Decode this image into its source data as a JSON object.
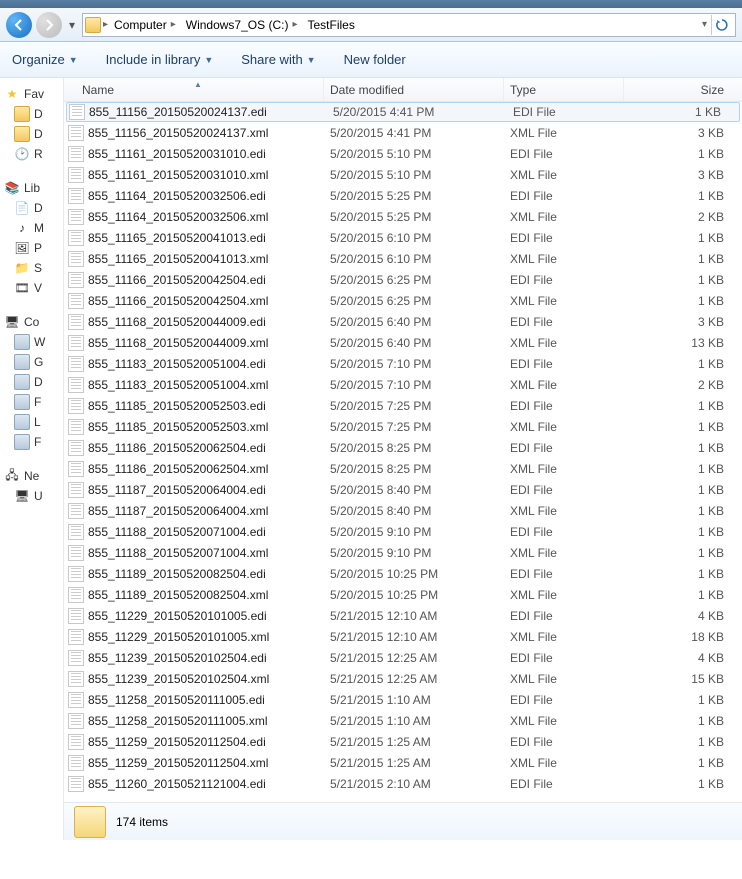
{
  "breadcrumb": [
    "Computer",
    "Windows7_OS (C:)",
    "TestFiles"
  ],
  "toolbar": {
    "organize": "Organize",
    "include": "Include in library",
    "share": "Share with",
    "newfolder": "New folder"
  },
  "columns": {
    "name": "Name",
    "date": "Date modified",
    "type": "Type",
    "size": "Size"
  },
  "sidebar": {
    "fav": "Fav",
    "fav_items": [
      "D",
      "D",
      "R"
    ],
    "lib": "Lib",
    "lib_items": [
      "D",
      "M",
      "P",
      "S",
      "V"
    ],
    "comp": "Co",
    "comp_items": [
      "W",
      "G",
      "D",
      "F",
      "L",
      "F"
    ],
    "net": "Ne",
    "net_items": [
      "U"
    ]
  },
  "files": [
    {
      "name": "855_11156_20150520024137.edi",
      "date": "5/20/2015 4:41 PM",
      "type": "EDI File",
      "size": "1 KB",
      "sel": true
    },
    {
      "name": "855_11156_20150520024137.xml",
      "date": "5/20/2015 4:41 PM",
      "type": "XML File",
      "size": "3 KB"
    },
    {
      "name": "855_11161_20150520031010.edi",
      "date": "5/20/2015 5:10 PM",
      "type": "EDI File",
      "size": "1 KB"
    },
    {
      "name": "855_11161_20150520031010.xml",
      "date": "5/20/2015 5:10 PM",
      "type": "XML File",
      "size": "3 KB"
    },
    {
      "name": "855_11164_20150520032506.edi",
      "date": "5/20/2015 5:25 PM",
      "type": "EDI File",
      "size": "1 KB"
    },
    {
      "name": "855_11164_20150520032506.xml",
      "date": "5/20/2015 5:25 PM",
      "type": "XML File",
      "size": "2 KB"
    },
    {
      "name": "855_11165_20150520041013.edi",
      "date": "5/20/2015 6:10 PM",
      "type": "EDI File",
      "size": "1 KB"
    },
    {
      "name": "855_11165_20150520041013.xml",
      "date": "5/20/2015 6:10 PM",
      "type": "XML File",
      "size": "1 KB"
    },
    {
      "name": "855_11166_20150520042504.edi",
      "date": "5/20/2015 6:25 PM",
      "type": "EDI File",
      "size": "1 KB"
    },
    {
      "name": "855_11166_20150520042504.xml",
      "date": "5/20/2015 6:25 PM",
      "type": "XML File",
      "size": "1 KB"
    },
    {
      "name": "855_11168_20150520044009.edi",
      "date": "5/20/2015 6:40 PM",
      "type": "EDI File",
      "size": "3 KB"
    },
    {
      "name": "855_11168_20150520044009.xml",
      "date": "5/20/2015 6:40 PM",
      "type": "XML File",
      "size": "13 KB"
    },
    {
      "name": "855_11183_20150520051004.edi",
      "date": "5/20/2015 7:10 PM",
      "type": "EDI File",
      "size": "1 KB"
    },
    {
      "name": "855_11183_20150520051004.xml",
      "date": "5/20/2015 7:10 PM",
      "type": "XML File",
      "size": "2 KB"
    },
    {
      "name": "855_11185_20150520052503.edi",
      "date": "5/20/2015 7:25 PM",
      "type": "EDI File",
      "size": "1 KB"
    },
    {
      "name": "855_11185_20150520052503.xml",
      "date": "5/20/2015 7:25 PM",
      "type": "XML File",
      "size": "1 KB"
    },
    {
      "name": "855_11186_20150520062504.edi",
      "date": "5/20/2015 8:25 PM",
      "type": "EDI File",
      "size": "1 KB"
    },
    {
      "name": "855_11186_20150520062504.xml",
      "date": "5/20/2015 8:25 PM",
      "type": "XML File",
      "size": "1 KB"
    },
    {
      "name": "855_11187_20150520064004.edi",
      "date": "5/20/2015 8:40 PM",
      "type": "EDI File",
      "size": "1 KB"
    },
    {
      "name": "855_11187_20150520064004.xml",
      "date": "5/20/2015 8:40 PM",
      "type": "XML File",
      "size": "1 KB"
    },
    {
      "name": "855_11188_20150520071004.edi",
      "date": "5/20/2015 9:10 PM",
      "type": "EDI File",
      "size": "1 KB"
    },
    {
      "name": "855_11188_20150520071004.xml",
      "date": "5/20/2015 9:10 PM",
      "type": "XML File",
      "size": "1 KB"
    },
    {
      "name": "855_11189_20150520082504.edi",
      "date": "5/20/2015 10:25 PM",
      "type": "EDI File",
      "size": "1 KB"
    },
    {
      "name": "855_11189_20150520082504.xml",
      "date": "5/20/2015 10:25 PM",
      "type": "XML File",
      "size": "1 KB"
    },
    {
      "name": "855_11229_20150520101005.edi",
      "date": "5/21/2015 12:10 AM",
      "type": "EDI File",
      "size": "4 KB"
    },
    {
      "name": "855_11229_20150520101005.xml",
      "date": "5/21/2015 12:10 AM",
      "type": "XML File",
      "size": "18 KB"
    },
    {
      "name": "855_11239_20150520102504.edi",
      "date": "5/21/2015 12:25 AM",
      "type": "EDI File",
      "size": "4 KB"
    },
    {
      "name": "855_11239_20150520102504.xml",
      "date": "5/21/2015 12:25 AM",
      "type": "XML File",
      "size": "15 KB"
    },
    {
      "name": "855_11258_20150520111005.edi",
      "date": "5/21/2015 1:10 AM",
      "type": "EDI File",
      "size": "1 KB"
    },
    {
      "name": "855_11258_20150520111005.xml",
      "date": "5/21/2015 1:10 AM",
      "type": "XML File",
      "size": "1 KB"
    },
    {
      "name": "855_11259_20150520112504.edi",
      "date": "5/21/2015 1:25 AM",
      "type": "EDI File",
      "size": "1 KB"
    },
    {
      "name": "855_11259_20150520112504.xml",
      "date": "5/21/2015 1:25 AM",
      "type": "XML File",
      "size": "1 KB"
    },
    {
      "name": "855_11260_20150521121004.edi",
      "date": "5/21/2015 2:10 AM",
      "type": "EDI File",
      "size": "1 KB"
    }
  ],
  "status": {
    "count": "174 items"
  }
}
